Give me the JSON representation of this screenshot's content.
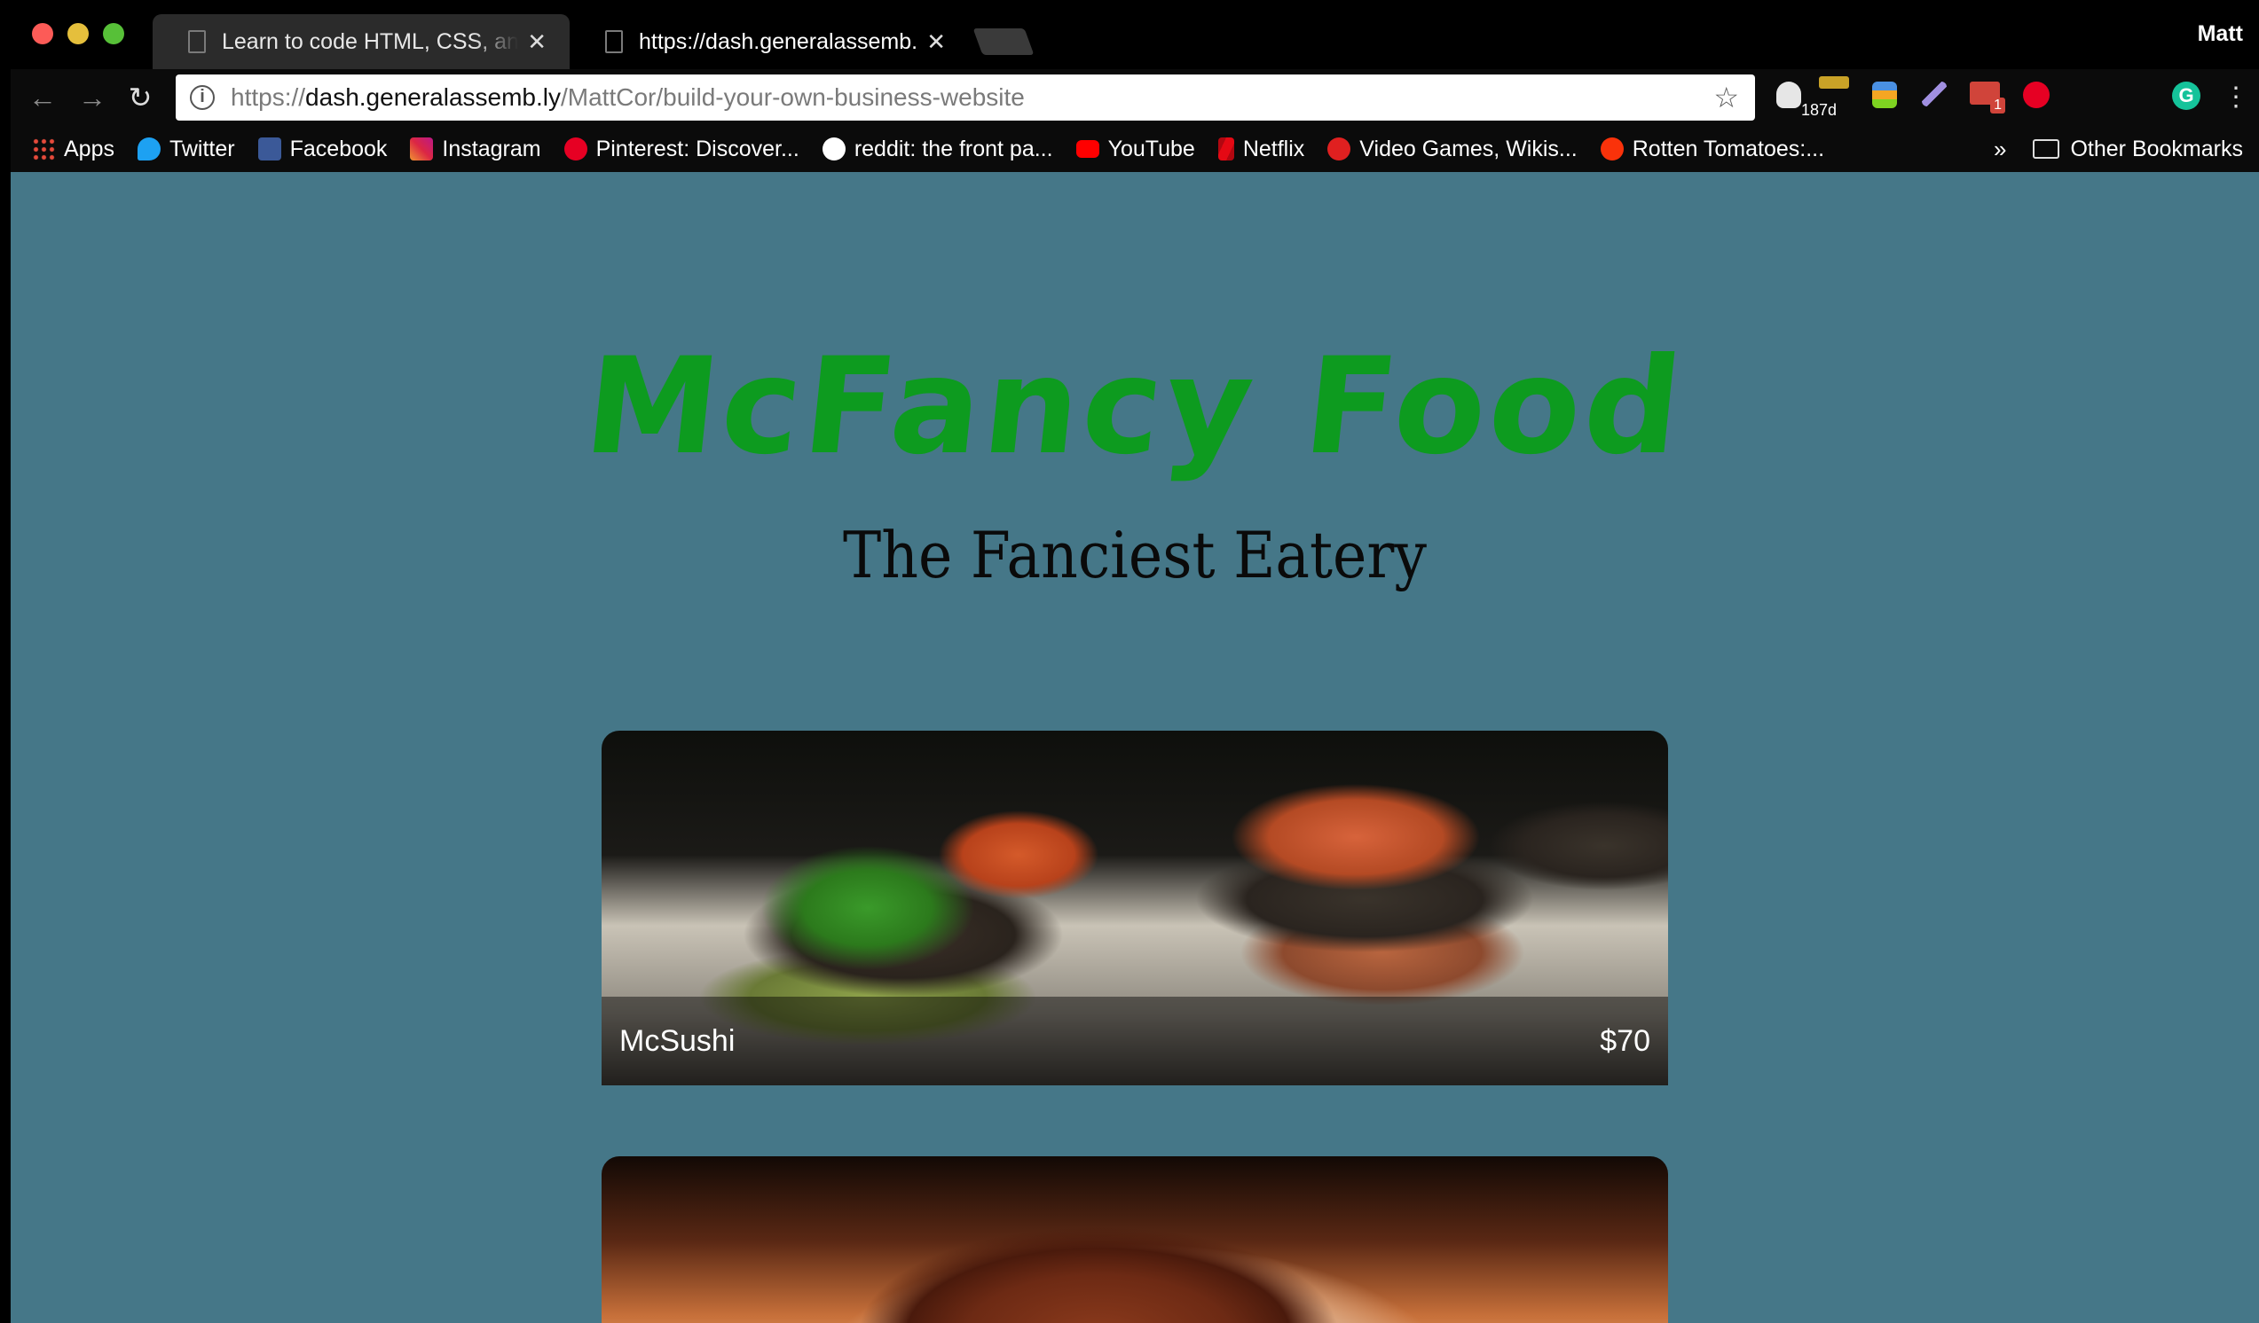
{
  "browser": {
    "tabs": [
      {
        "title": "Learn to code HTML, CSS, and JavaScript",
        "active": false
      },
      {
        "title": "https://dash.generalassemb.ly/MattCor/build-your-own-business-website",
        "active": true
      }
    ],
    "user": "Matt",
    "omnibox": {
      "scheme": "https://",
      "host": "dash.generalassemb.ly",
      "path": "/MattCor/build-your-own-business-website"
    },
    "extensions": {
      "timer_label": "187d",
      "mail_badge": "1"
    },
    "bookmarks": [
      {
        "label": "Apps",
        "icon": "apps-grid-icon",
        "color": "#e64a3b"
      },
      {
        "label": "Twitter",
        "icon": "twitter-icon",
        "color": "#1da1f2"
      },
      {
        "label": "Facebook",
        "icon": "facebook-icon",
        "color": "#3b5998"
      },
      {
        "label": "Instagram",
        "icon": "instagram-icon",
        "color": "#c13584"
      },
      {
        "label": "Pinterest: Discover...",
        "icon": "pinterest-icon",
        "color": "#e60023"
      },
      {
        "label": "reddit: the front pa...",
        "icon": "reddit-icon",
        "color": "#ff4500"
      },
      {
        "label": "YouTube",
        "icon": "youtube-icon",
        "color": "#ff0000"
      },
      {
        "label": "Netflix",
        "icon": "netflix-icon",
        "color": "#e50914"
      },
      {
        "label": "Video Games, Wikis...",
        "icon": "fandom-icon",
        "color": "#e02020"
      },
      {
        "label": "Rotten Tomatoes:...",
        "icon": "tomato-icon",
        "color": "#fa320a"
      }
    ],
    "bookmarks_more": "»",
    "other_bookmarks": "Other Bookmarks"
  },
  "site": {
    "title": "McFancy Food",
    "subtitle": "The Fanciest Eatery",
    "title_color": "#0d9b1f",
    "background_color": "#457788",
    "menu": [
      {
        "name": "McSushi",
        "price": "$70"
      },
      {
        "name": "",
        "price": ""
      }
    ]
  }
}
